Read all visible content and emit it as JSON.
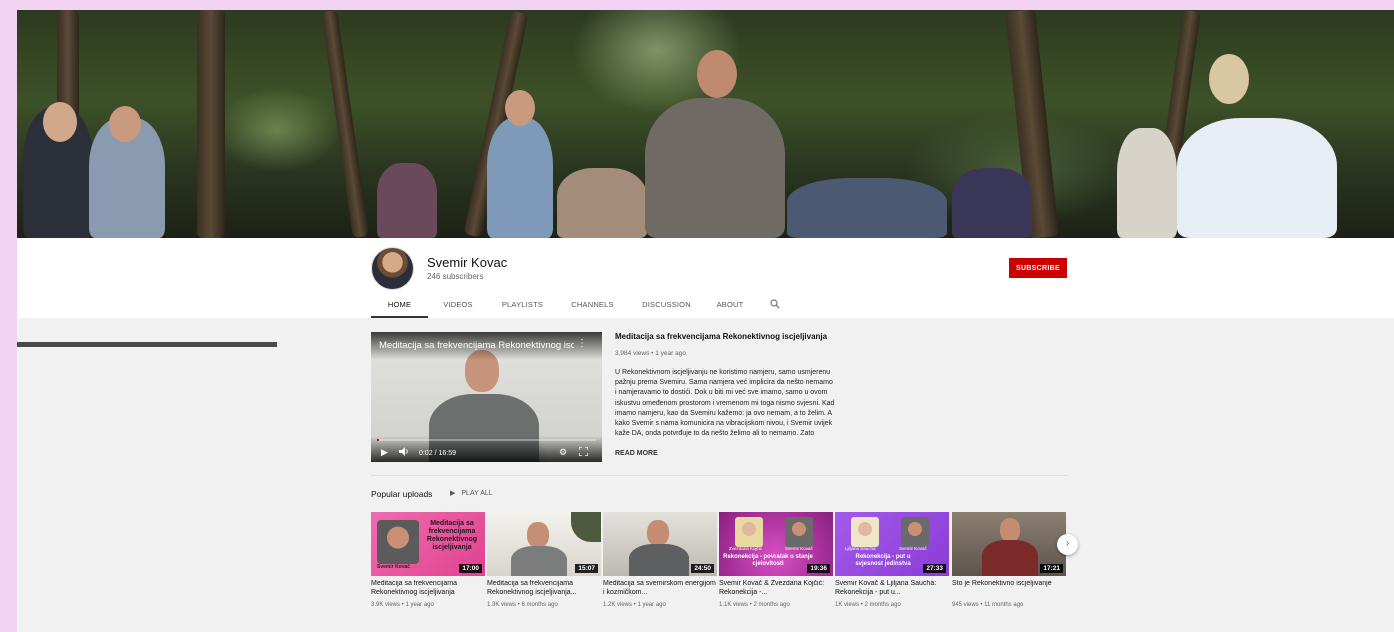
{
  "channel": {
    "name": "Svemir Kovac",
    "subscribers": "246 subscribers",
    "subscribe_label": "SUBSCRIBE"
  },
  "tabs": [
    {
      "label": "HOME",
      "active": true
    },
    {
      "label": "VIDEOS"
    },
    {
      "label": "PLAYLISTS"
    },
    {
      "label": "CHANNELS"
    },
    {
      "label": "DISCUSSION"
    },
    {
      "label": "ABOUT"
    }
  ],
  "featured": {
    "player_title": "Meditacija sa frekvencijama Rekonektivnog iscjeljivanja",
    "time": "0:02 / 16:59",
    "progress": 0.002,
    "title": "Meditacija sa frekvencijama Rekonektivnog iscjeljivanja",
    "meta": "3,984 views • 1 year ago",
    "description": "U Rekonektivnom iscjeljivanju ne koristimo namjeru, samo usmjerenu pažnju prema Svemiru.  Sama namjera već implicira da nešto nemamo i namjeravamo to dostići.  Dok u biti mi već sve imamo, samo u ovom iskustvu omeđenom prostorom i vremenom mi toga nismo svjesni.  Kad imamo namjeru, kao da Svemiru kažemo:  ja ovo nemam, a to želim.  A kako Svemir s nama komunicira na vibracijskom nivou, i Svemir uvijek kaže DA, onda potvrđuje to da nešto želimo ali to nemamo.  Zato",
    "read_more": "READ MORE"
  },
  "popular": {
    "title": "Popular uploads",
    "play_all": "PLAY ALL",
    "videos": [
      {
        "title": "Meditacija sa frekvencijama Rekonektivnog iscjeljivanja",
        "meta": "3.9K views • 1 year ago",
        "duration": "17:00",
        "thumb_text": "Meditacija sa frekvencijama Rekonektivnog iscjeljivanja",
        "thumb_caption": "Svemir Kovač"
      },
      {
        "title": "Meditacija sa frekvencijama Rekonektivnog iscjeljivanja...",
        "meta": "1.3K views • 6 months ago",
        "duration": "15:07"
      },
      {
        "title": "Meditacija sa svemirskom energijom i kozmičkom...",
        "meta": "1.2K views • 1 year ago",
        "duration": "24:50"
      },
      {
        "title": "Svemir Kovač & Zvezdana Kojčić: Rekonekcija -...",
        "meta": "1.1K views • 2 months ago",
        "duration": "19:36",
        "thumb_text": "Rekonekcija - povratak u stanje cjelovitosti",
        "thumb_names": [
          "Zvezdana Kojčić",
          "Svemir Kovač"
        ]
      },
      {
        "title": "Svemir Kovač & Ljiljana Saucha: Rekonekcija - put u...",
        "meta": "1K views • 2 months ago",
        "duration": "27:33",
        "thumb_text": "Rekonekcija - put u svjesnost jedinstva",
        "thumb_names": [
          "Ljiljana Saucha",
          "Svemir Kovač"
        ]
      },
      {
        "title": "Što je Rekonektivno iscjeljivanje",
        "meta": "945 views • 11 months ago",
        "duration": "17:21"
      }
    ]
  },
  "colors": {
    "page_bg": "#f3d3f3",
    "subscribe": "#cc0000",
    "pink_thumb": "#e94fa0",
    "magenta_thumb": "#b52ca8",
    "purple_thumb": "#9a45e0"
  },
  "icons": {
    "search": "search-icon",
    "play": "play-icon",
    "volume": "volume-icon",
    "settings": "gear-icon",
    "fullscreen": "fullscreen-icon",
    "next": "chevron-right-icon"
  }
}
